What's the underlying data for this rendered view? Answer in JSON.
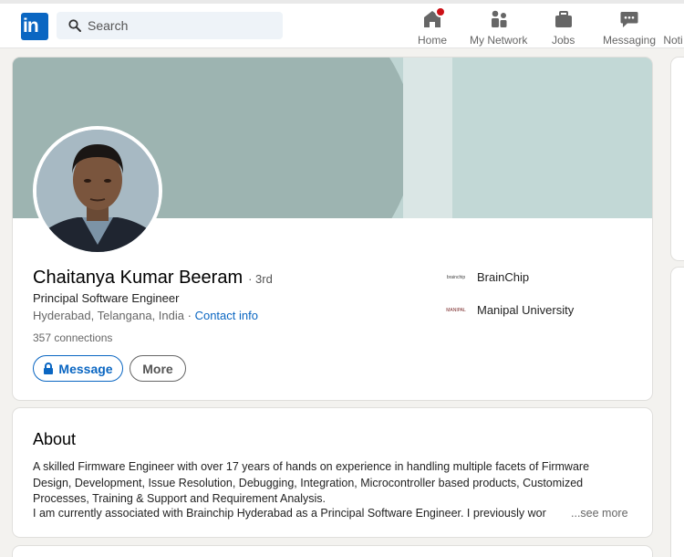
{
  "nav": {
    "search_placeholder": "Search",
    "items": [
      {
        "label": "Home",
        "icon": "home-icon"
      },
      {
        "label": "My Network",
        "icon": "network-icon"
      },
      {
        "label": "Jobs",
        "icon": "briefcase-icon"
      },
      {
        "label": "Messaging",
        "icon": "messaging-icon"
      },
      {
        "label": "Noti",
        "icon": "bell-icon"
      }
    ],
    "logo_text": "in"
  },
  "profile": {
    "name": "Chaitanya Kumar Beeram",
    "degree": "· 3rd",
    "headline": "Principal Software Engineer",
    "location": "Hyderabad, Telangana, India ·",
    "contact_info": "Contact info",
    "connections": "357 connections",
    "message_label": "Message",
    "more_label": "More",
    "orgs": [
      {
        "name": "BrainChip",
        "logo_text": "brainchip"
      },
      {
        "name": "Manipal University",
        "logo_text": "MANIPAL"
      }
    ]
  },
  "about": {
    "title": "About",
    "text": "A skilled Firmware Engineer with over 17 years of hands on experience in handling multiple facets of Firmware Design, Development, Issue Resolution, Debugging, Integration, Microcontroller based products, Customized Processes, Training & Support and Requirement Analysis.",
    "text_line2": "I am currently associated with Brainchip Hyderabad as a Principal Software Engineer. I previously wor",
    "see_more": "...see more"
  },
  "colors": {
    "brand": "#0a66c2",
    "badge": "#cc1016"
  }
}
